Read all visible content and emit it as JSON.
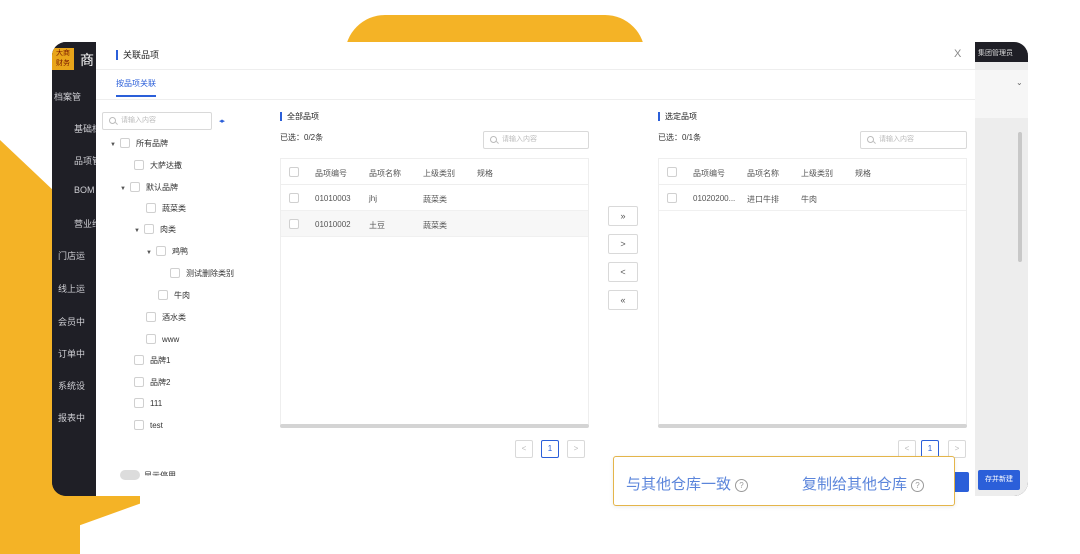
{
  "colors": {
    "accent": "#2b5fd9",
    "brand_yellow": "#f4b326",
    "dark_nav": "#1f1f26",
    "tooltip_text": "#5b85db"
  },
  "app": {
    "logo_text": "大商 财务",
    "title": "商",
    "user_label": "集团管理员",
    "sidebar": [
      {
        "label": "档案管",
        "icon": "file-icon"
      },
      {
        "label": "基础档",
        "icon": ""
      },
      {
        "label": "品项管",
        "icon": ""
      },
      {
        "label": "BOM",
        "icon": ""
      },
      {
        "label": "营业维",
        "icon": ""
      },
      {
        "label": "门店运",
        "icon": "store-icon"
      },
      {
        "label": "线上运",
        "icon": "online-icon"
      },
      {
        "label": "会员中",
        "icon": "member-icon"
      },
      {
        "label": "订单中",
        "icon": "order-icon"
      },
      {
        "label": "系统设",
        "icon": "settings-icon"
      },
      {
        "label": "报表中",
        "icon": "report-icon"
      }
    ],
    "save_new": "存并新建"
  },
  "dialog": {
    "title": "关联品项",
    "close": "X",
    "tab": "按品项关联",
    "tree": {
      "search_placeholder": "请输入内容",
      "nodes": [
        {
          "label": "所有品牌",
          "caret": "▼"
        },
        {
          "label": "大萨达撒",
          "caret": ""
        },
        {
          "label": "默认品牌",
          "caret": "▼"
        },
        {
          "label": "蔬菜类",
          "caret": ""
        },
        {
          "label": "肉类",
          "caret": "▼"
        },
        {
          "label": "鸡鸭",
          "caret": "▼"
        },
        {
          "label": "测试删除类别",
          "caret": ""
        },
        {
          "label": "牛肉",
          "caret": ""
        },
        {
          "label": "酒水类",
          "caret": ""
        },
        {
          "label": "www",
          "caret": ""
        },
        {
          "label": "品牌1",
          "caret": ""
        },
        {
          "label": "品牌2",
          "caret": ""
        },
        {
          "label": "111",
          "caret": ""
        },
        {
          "label": "test",
          "caret": ""
        }
      ],
      "toggle_label": "显示停用"
    },
    "all_items": {
      "title": "全部品项",
      "count": "已选：0/2条",
      "search_placeholder": "请输入内容",
      "columns": [
        "品项编号",
        "品项名称",
        "上级类别",
        "规格"
      ],
      "rows": [
        [
          "01010003",
          "jhj",
          "蔬菜类",
          ""
        ],
        [
          "01010002",
          "土豆",
          "蔬菜类",
          ""
        ]
      ],
      "page": "1"
    },
    "selected_items": {
      "title": "选定品项",
      "count": "已选：0/1条",
      "search_placeholder": "请输入内容",
      "columns": [
        "品项编号",
        "品项名称",
        "上级类别",
        "规格"
      ],
      "rows": [
        [
          "01020200...",
          "进口牛排",
          "牛肉",
          ""
        ]
      ],
      "page": "1"
    },
    "transfer": {
      "move_all_right": "»",
      "move_right": ">",
      "move_left": "<",
      "move_all_left": "«"
    },
    "pager": {
      "prev": "<",
      "next": ">"
    }
  },
  "tooltip": {
    "same_as_other": "与其他仓库一致",
    "copy_to_other": "复制给其他仓库",
    "help": "?"
  }
}
